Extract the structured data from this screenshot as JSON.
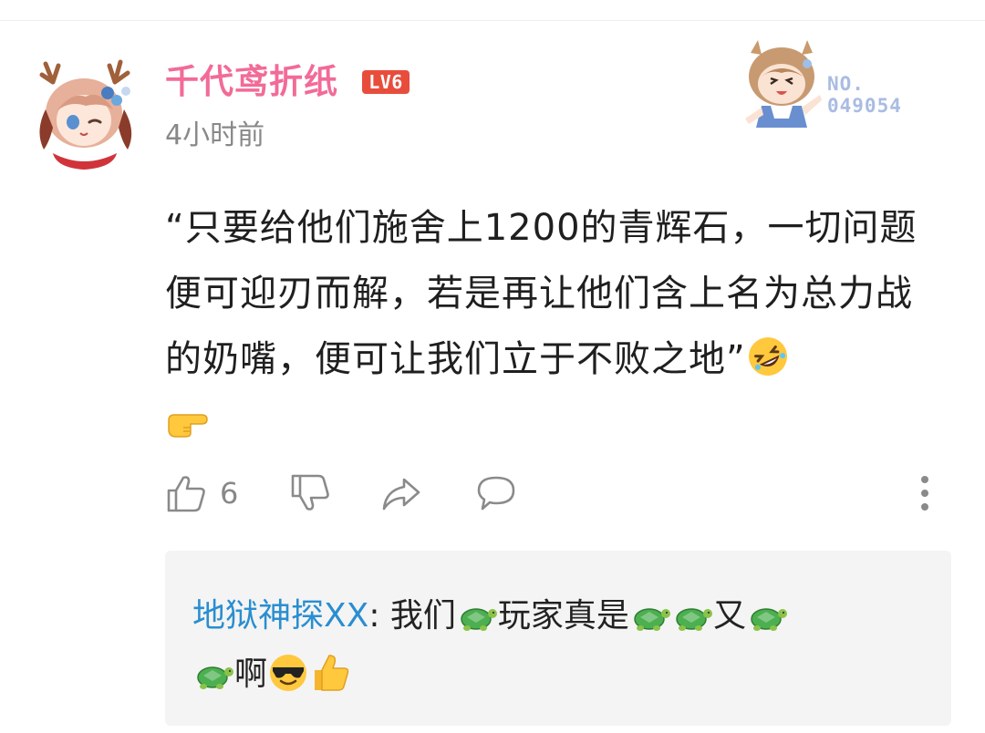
{
  "comment": {
    "username": "千代鸢折纸",
    "level_badge": "LV6",
    "timestamp": "4小时前",
    "fan_badge": {
      "line1": "NO.",
      "line2": "049054"
    },
    "text": "“只要给他们施舍上1200的青辉石，一切问题便可迎刃而解，若是再让他们含上名为总力战的奶嘴，便可让我们立于不败之地”",
    "emojis": [
      "rolling-on-floor-laughing-emoji",
      "pointing-right-emoji"
    ],
    "actions": {
      "like_count": "6"
    }
  },
  "reply": {
    "username": "地狱神探XX",
    "separator": ": ",
    "segments": [
      "我们",
      "玩家真是",
      "又",
      "啊"
    ],
    "emojis": [
      "turtle-emoji",
      "sunglasses-emoji",
      "thumbs-up-emoji"
    ]
  },
  "colors": {
    "username": "#f26b96",
    "level_badge": "#e84d3c",
    "reply_user": "#2a8ed0",
    "reply_background": "#f4f4f4"
  }
}
